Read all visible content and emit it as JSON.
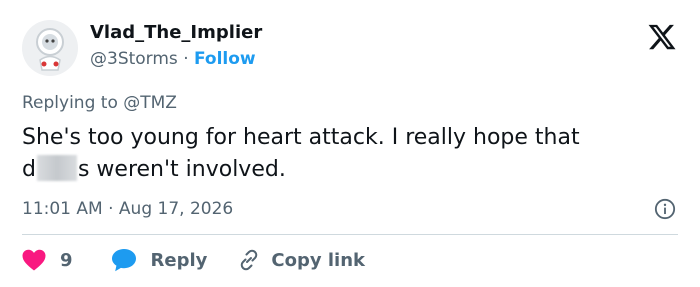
{
  "user": {
    "display_name": "Vlad_The_Implier",
    "handle": "@3Storms",
    "separator": "·",
    "follow_label": "Follow"
  },
  "header": {
    "logo_icon": "x-logo-icon"
  },
  "tweet": {
    "reply_context_prefix": "Replying to ",
    "reply_context_handle": "@TMZ",
    "text_line1": "She's too young for heart attack. I really hope that",
    "text_line2_start": "d",
    "text_line2_end": "s weren't involved.",
    "time": "11:01 AM",
    "date_separator": "·",
    "date": "Aug 17, 2026"
  },
  "actions": {
    "like_count": "9",
    "reply_label": "Reply",
    "copy_link_label": "Copy link"
  },
  "colors": {
    "text": "#0f1419",
    "muted": "#536471",
    "accent": "#1d9bf0",
    "like": "#f91880",
    "divider": "#cfd9de"
  }
}
